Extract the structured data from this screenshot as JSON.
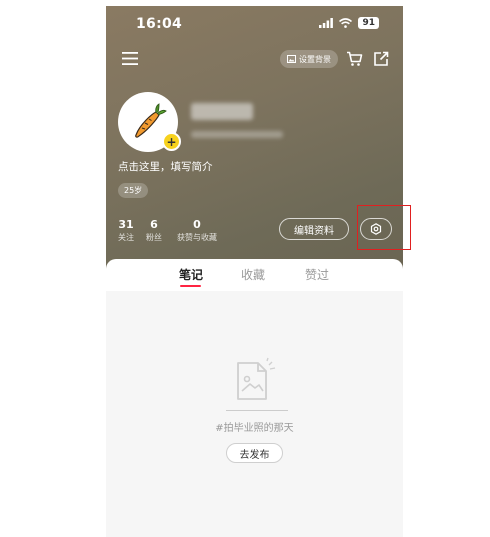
{
  "status_bar": {
    "time": "16:04",
    "battery": "91"
  },
  "header": {
    "set_background_label": "设置背景"
  },
  "profile": {
    "bio": "点击这里，填写简介",
    "age_badge": "25岁"
  },
  "stats": [
    {
      "value": "31",
      "label": "关注"
    },
    {
      "value": "6",
      "label": "粉丝"
    },
    {
      "value": "0",
      "label": "获赞与收藏"
    }
  ],
  "actions": {
    "edit_profile_label": "编辑资料"
  },
  "tabs": [
    {
      "label": "笔记",
      "active": true
    },
    {
      "label": "收藏",
      "active": false
    },
    {
      "label": "赞过",
      "active": false
    }
  ],
  "empty_state": {
    "text": "#拍毕业照的那天",
    "button_label": "去发布"
  },
  "colors": {
    "accent": "#ff2442",
    "highlight": "#e02020",
    "badge_yellow": "#f7d21d"
  }
}
